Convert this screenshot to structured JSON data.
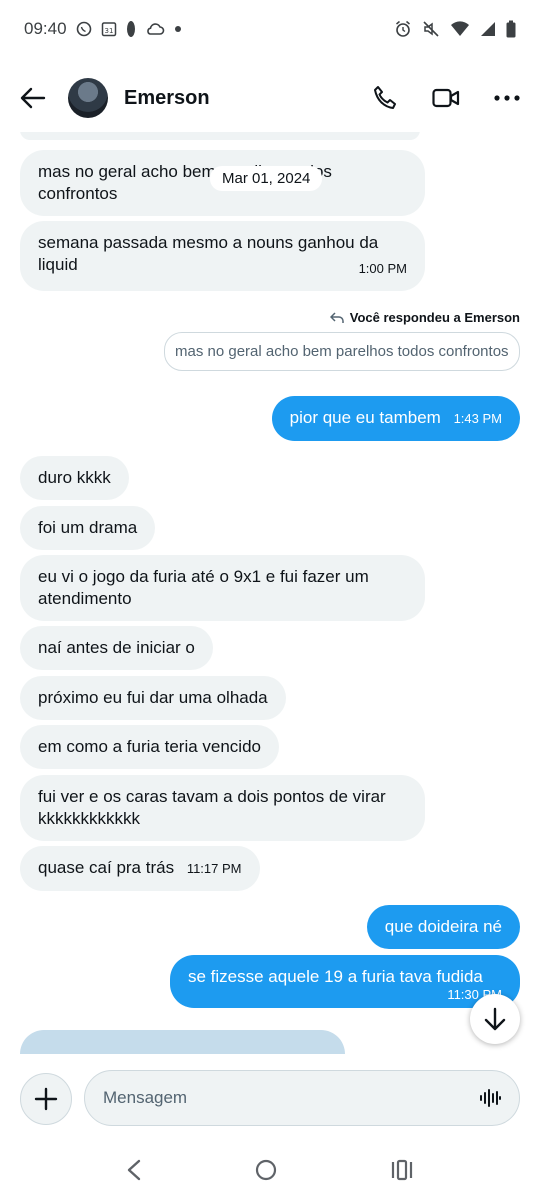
{
  "status_bar": {
    "time": "09:40",
    "calendar_day": "31",
    "icons": [
      "whatsapp-icon",
      "calendar-icon",
      "leaf-icon",
      "cloud-icon",
      "dot-icon",
      "alarm-icon",
      "mute-icon",
      "wifi-icon",
      "signal-icon",
      "battery-icon"
    ]
  },
  "header": {
    "contact_name": "Emerson",
    "icons": [
      "back-arrow-icon",
      "phone-icon",
      "video-icon",
      "more-icon"
    ]
  },
  "chat": {
    "date_chip": "Mar 01, 2024",
    "messages": [
      {
        "dir": "in",
        "text": "mas no geral acho bem parelhos todos confrontos",
        "time": ""
      },
      {
        "dir": "in",
        "text": "semana passada mesmo a nouns ganhou da liquid",
        "time": "1:00 PM"
      },
      {
        "dir": "out",
        "text": "pior que eu tambem",
        "time": "1:43 PM"
      },
      {
        "dir": "in",
        "text": "duro kkkk",
        "time": ""
      },
      {
        "dir": "in",
        "text": "foi um drama",
        "time": ""
      },
      {
        "dir": "in",
        "text": "eu vi o jogo da furia até o 9x1 e fui fazer um atendimento",
        "time": ""
      },
      {
        "dir": "in",
        "text": "naí antes de iniciar o",
        "time": ""
      },
      {
        "dir": "in",
        "text": "próximo eu fui dar uma olhada",
        "time": ""
      },
      {
        "dir": "in",
        "text": "em como a furia teria vencido",
        "time": ""
      },
      {
        "dir": "in",
        "text": "fui ver e os caras tavam a dois pontos de virar kkkkkkkkkkkk",
        "time": ""
      },
      {
        "dir": "in",
        "text": "quase caí pra trás",
        "time": "11:17 PM"
      },
      {
        "dir": "out",
        "text": "que doideira né",
        "time": ""
      },
      {
        "dir": "out",
        "text": "se fizesse aquele 19 a furia tava fudida",
        "time": "11:30 PM"
      }
    ],
    "reply_note": "Você respondeu a Emerson",
    "quoted_text": "mas no geral acho bem parelhos todos confrontos"
  },
  "composer": {
    "placeholder": "Mensagem"
  },
  "colors": {
    "outgoing": "#1d9bf0",
    "incoming": "#eff3f4",
    "text": "#0f1419"
  }
}
